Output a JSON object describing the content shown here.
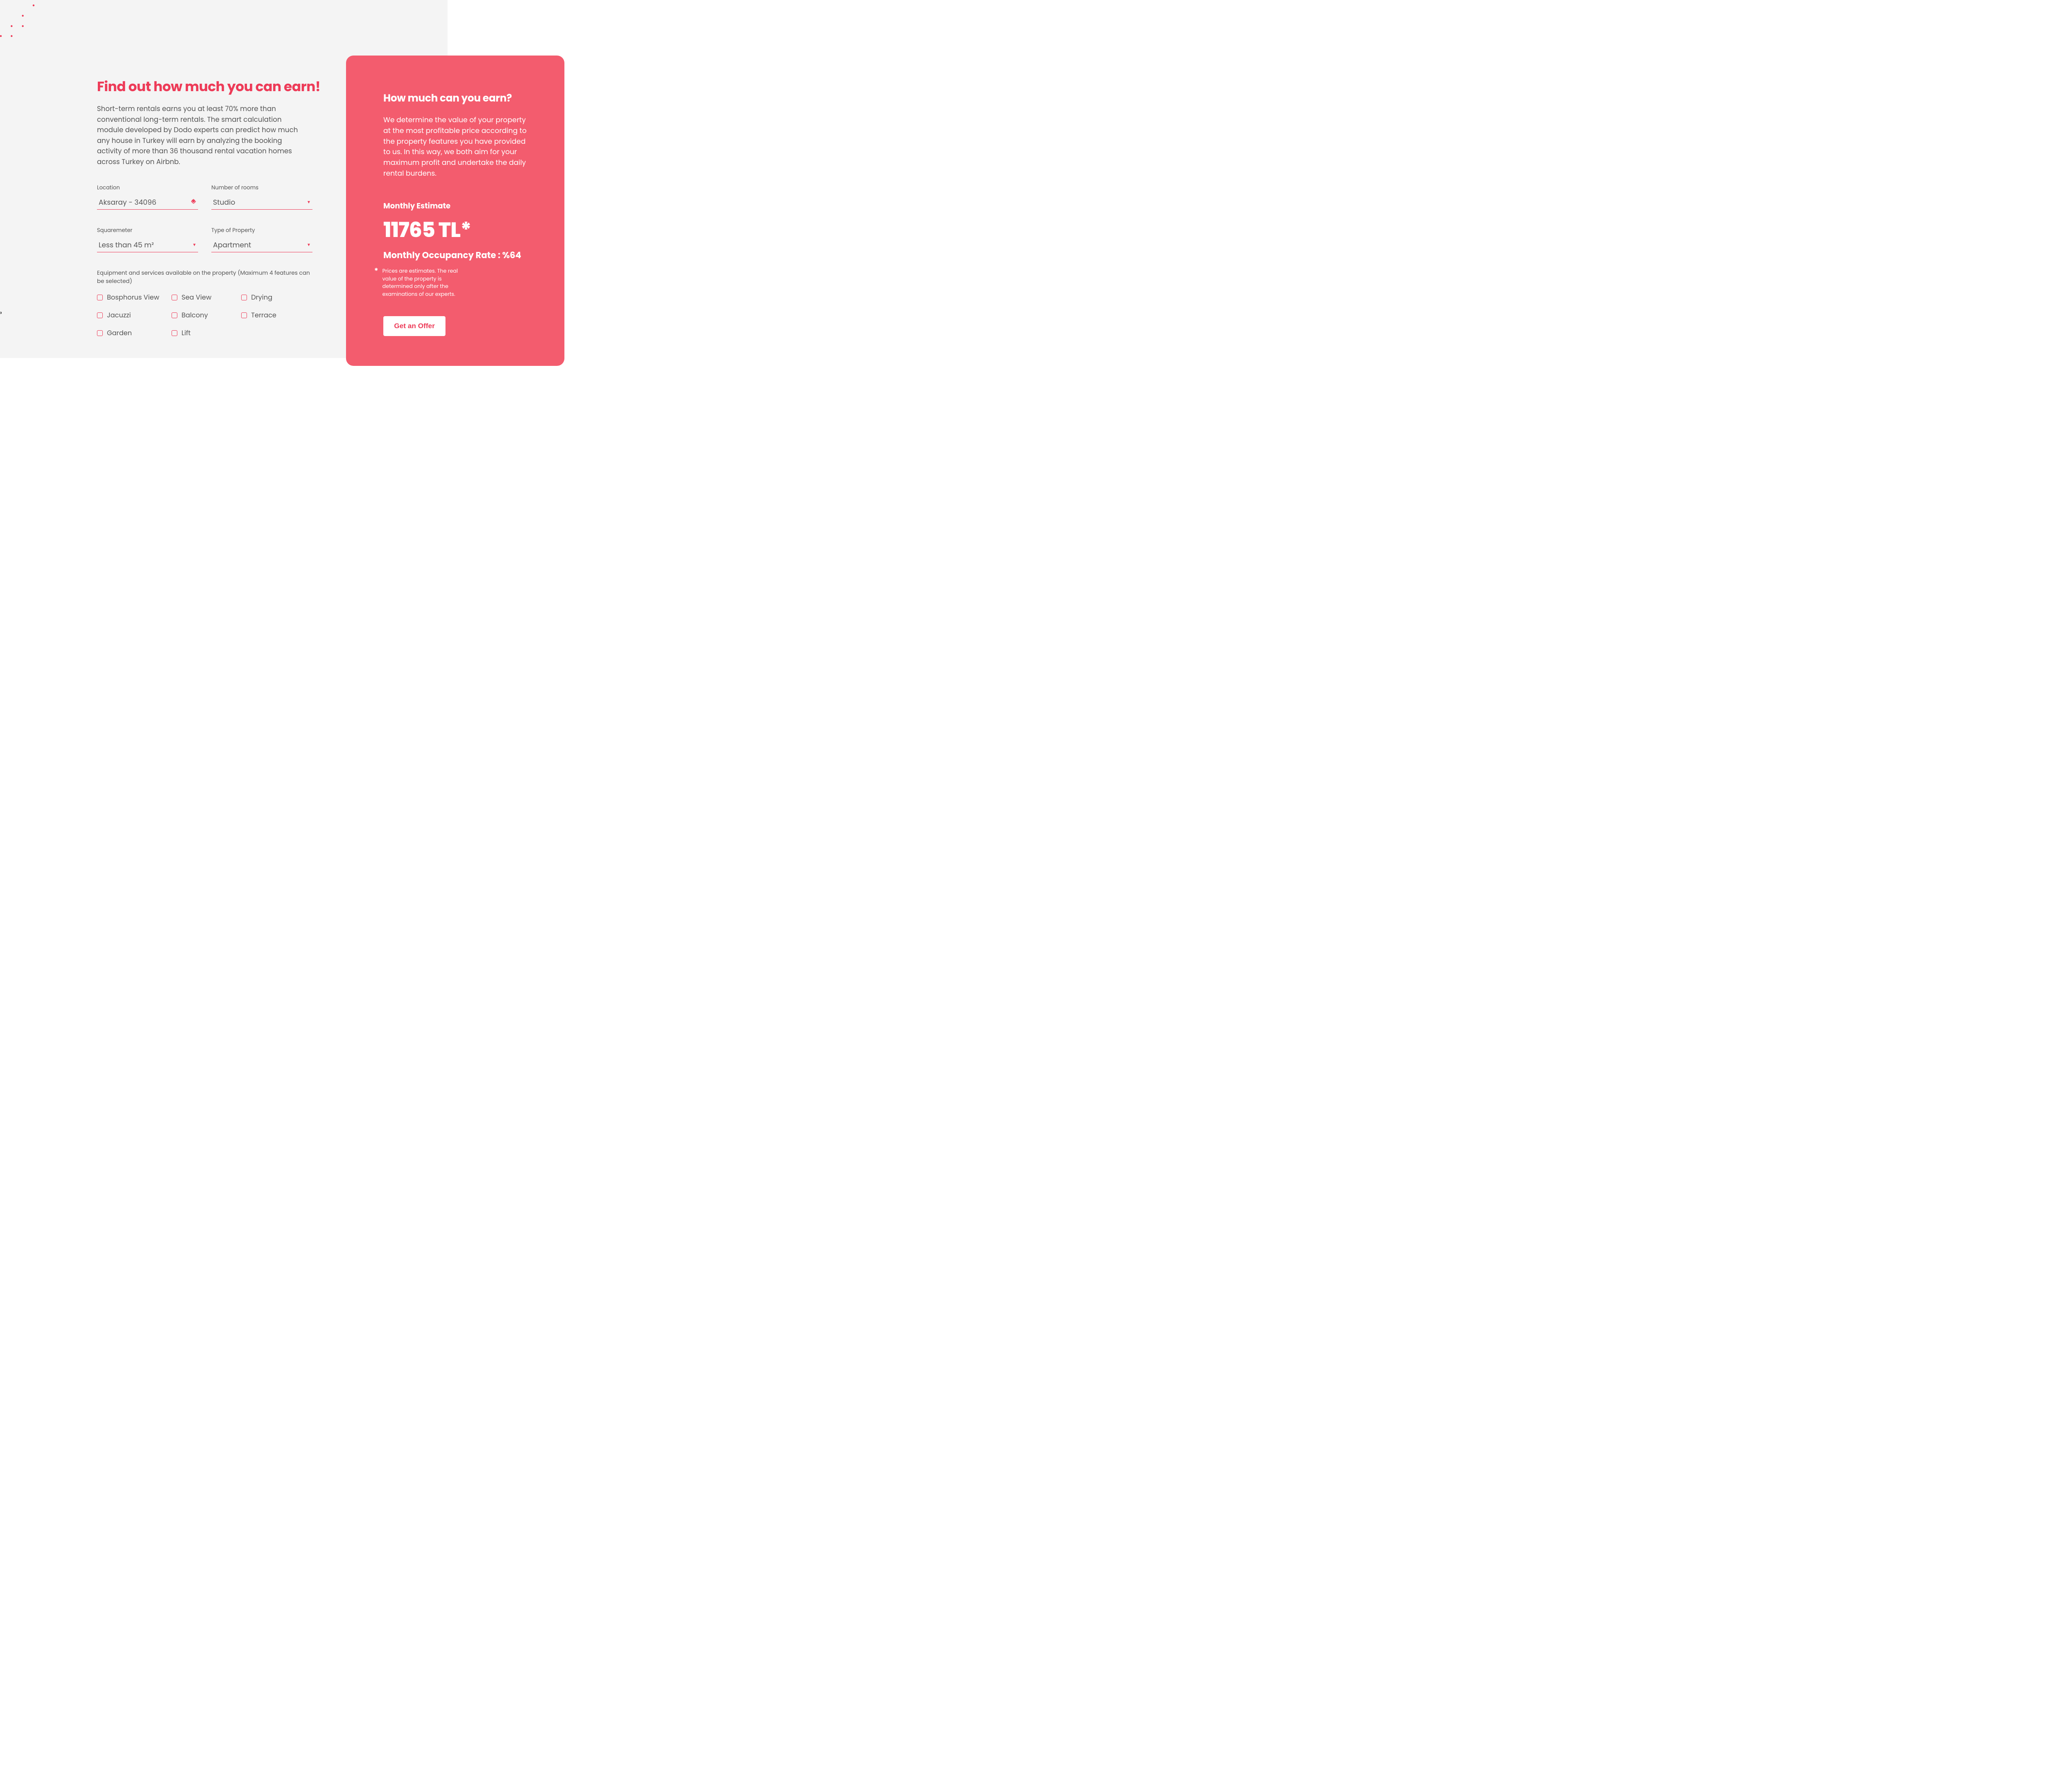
{
  "colors": {
    "accent": "#ed3b58",
    "card": "#f35c6e",
    "leftBg": "#f4f4f4"
  },
  "heading": "Find out how much you can earn!",
  "intro": "Short-term rentals earns you at least 70% more than conventional long-term rentals. The smart calculation module developed by Dodo experts can predict how much any house in Turkey will earn by analyzing the booking activity of more than 36 thousand rental vacation homes across Turkey on Airbnb.",
  "form": {
    "location": {
      "label": "Location",
      "value": "Aksaray - 34096"
    },
    "rooms": {
      "label": "Number of rooms",
      "value": "Studio"
    },
    "sqm": {
      "label": "Squaremeter",
      "value": "Less than 45 m²"
    },
    "type": {
      "label": "Type of Property",
      "value": "Apartment"
    },
    "equipment_label": "Equipment and services available on the property (Maximum 4 features can be selected)",
    "features": {
      "bosphorus": "Bosphorus View",
      "sea": "Sea View",
      "drying": "Drying",
      "jacuzzi": "Jacuzzi",
      "balcony": "Balcony",
      "terrace": "Terrace",
      "garden": "Garden",
      "lift": "Lift"
    }
  },
  "card": {
    "heading": "How much can you earn?",
    "text": "We determine the value of your property at the most profitable price according to the property features you have provided to us. In this way, we both aim for your maximum profit and undertake the daily rental burdens.",
    "estimate_label": "Monthly Estimate",
    "estimate_value": "11765 TL*",
    "occupancy": "Monthly Occupancy Rate : %64",
    "disclaimer_star": "*",
    "disclaimer": "Prices are estimates. The real value of the property is determined only after the examinations of our experts.",
    "cta": "Get an Offer"
  },
  "icons": {
    "caret_down": "▼",
    "chevron_right": "›"
  }
}
